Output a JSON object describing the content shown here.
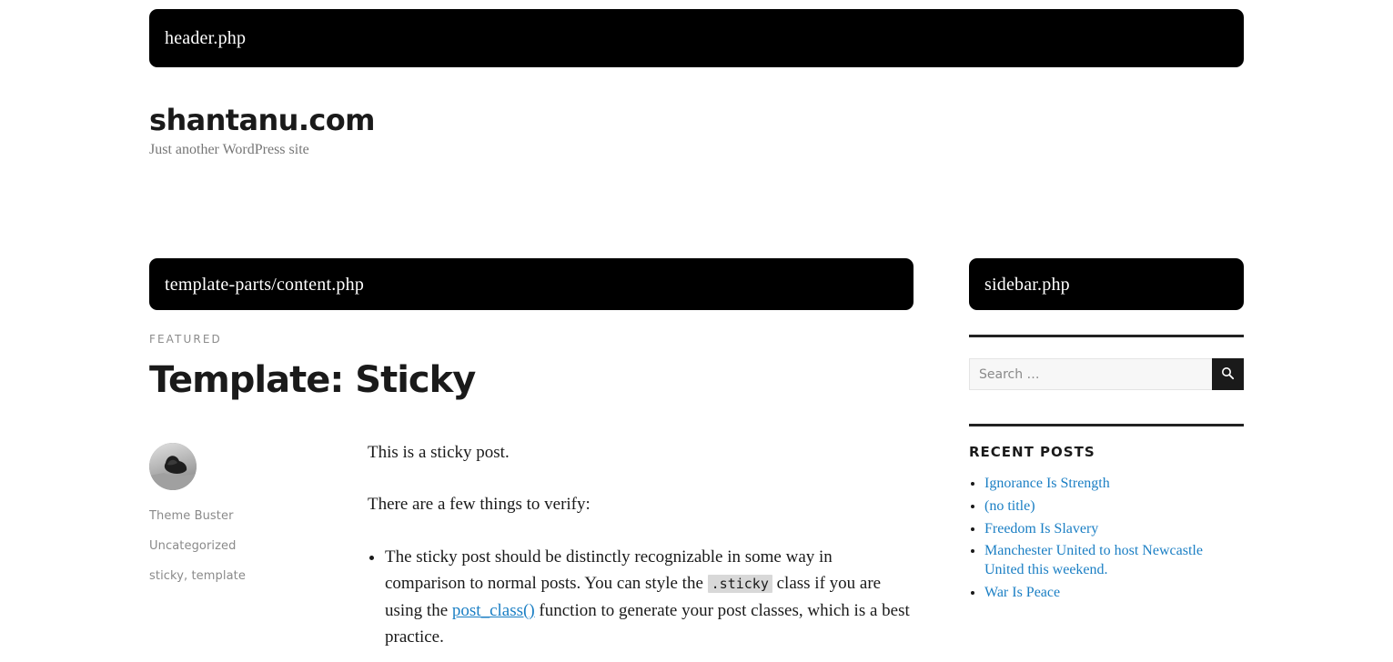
{
  "header": {
    "file_label": "header.php",
    "site_title": "shantanu.com",
    "site_description": "Just another WordPress site"
  },
  "content": {
    "file_label": "template-parts/content.php",
    "featured_label": "FEATURED",
    "entry_title": "Template: Sticky",
    "meta": {
      "avatar_alt": "author-avatar",
      "author": "Theme Buster",
      "category": "Uncategorized",
      "tags": "sticky, template"
    },
    "paragraph_1": "This is a sticky post.",
    "paragraph_2": "There are a few things to verify:",
    "list_item_1": {
      "part_1": "The sticky post should be distinctly recognizable in some way in comparison to normal posts. You can style the ",
      "code_1": ".sticky",
      "part_2": " class if you are using the ",
      "link_1": "post_class()",
      "part_3": " function to generate your post classes, which is a best practice."
    }
  },
  "sidebar": {
    "file_label": "sidebar.php",
    "search": {
      "placeholder": "Search …",
      "value": "",
      "icon": "search-icon"
    },
    "recent_posts": {
      "title": "Recent Posts",
      "items": [
        {
          "label": "Ignorance Is Strength"
        },
        {
          "label": "(no title)"
        },
        {
          "label": "Freedom Is Slavery"
        },
        {
          "label": "Manchester United to host Newcastle United this weekend."
        },
        {
          "label": "War Is Peace"
        }
      ]
    }
  },
  "colors": {
    "link": "#1b7fc4",
    "box_bg": "#000000",
    "rule": "#222222",
    "muted_text": "#8a8a8a",
    "code_bg": "#d8d8d8"
  }
}
